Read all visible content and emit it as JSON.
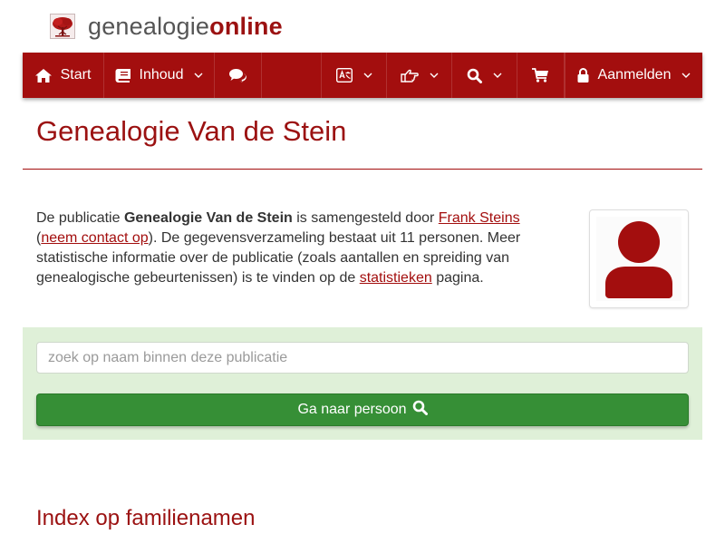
{
  "header": {
    "logo_part1": "genealogie",
    "logo_part2": "online",
    "logo_icon": "tree-icon"
  },
  "navbar": {
    "start_label": "Start",
    "inhoud_label": "Inhoud",
    "aanmelden_label": "Aanmelden",
    "icons": [
      "home-icon",
      "book-icon",
      "comments-icon",
      "language-icon",
      "hand-pointer-icon",
      "search-icon",
      "shopping-cart-icon",
      "lock-icon"
    ],
    "background_color": "#a30e0e"
  },
  "page": {
    "title": "Genealogie Van de Stein"
  },
  "intro": {
    "t1": "De publicatie ",
    "publication": "Genealogie Van de Stein",
    "t2": " is samengesteld door ",
    "author": "Frank Steins",
    "t3": "(",
    "contact_link": "neem contact op",
    "t4": "). De gegevensverzameling bestaat uit 11 personen. Meer statistische informatie over de publicatie (zoals aantallen en spreiding van genealogische gebeurtenissen) is te vinden op de ",
    "stats_link": "statistieken",
    "t5": " pagina."
  },
  "search": {
    "placeholder": "zoek op naam binnen deze publicatie",
    "value": "",
    "button_label": "Ga naar persoon",
    "panel_color": "#dff0d8",
    "button_color": "#368f36"
  },
  "index": {
    "title": "Index op familienamen"
  },
  "colors": {
    "brand": "#9b1111",
    "link": "#a30e0e"
  }
}
